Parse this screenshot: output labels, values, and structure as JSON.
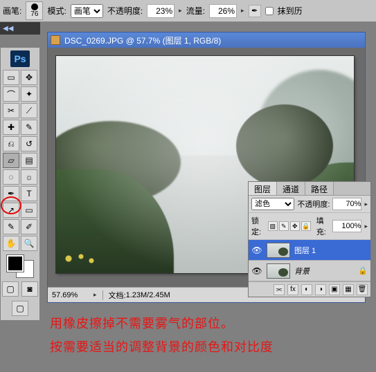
{
  "options_bar": {
    "brush_label": "画笔:",
    "brush_size": "76",
    "mode_label": "模式:",
    "mode_value": "画笔",
    "opacity_label": "不透明度:",
    "opacity_value": "23%",
    "flow_label": "流量:",
    "flow_value": "26%",
    "erase_history_label": "抹到历"
  },
  "collapse_glyph": "◀◀",
  "ps_logo": "Ps",
  "doc": {
    "title": "DSC_0269.JPG @ 57.7% (图层 1, RGB/8)"
  },
  "status": {
    "zoom": "57.69%",
    "info_label": "文档:",
    "info_value": "1.23M/2.45M"
  },
  "layers_panel": {
    "tabs": {
      "layers": "图层",
      "channels": "通道",
      "paths": "路径"
    },
    "blend_mode": "滤色",
    "opacity_label": "不透明度:",
    "opacity_value": "70%",
    "lock_label": "锁定:",
    "fill_label": "填充:",
    "fill_value": "100%",
    "layer1_name": "图层 1",
    "bg_name": "背景"
  },
  "annotations": {
    "line1": "用橡皮擦掉不需要雾气的部位。",
    "line2": "按需要适当的调整背景的颜色和对比度"
  },
  "icons": {
    "airbrush": "✒",
    "move": "✥",
    "marquee": "▭",
    "lasso": "⌒",
    "wand": "✦",
    "crop": "✂",
    "slice": "⟋",
    "heal": "✚",
    "brush": "✎",
    "stamp": "⎌",
    "history": "↺",
    "eraser": "▱",
    "grad": "▤",
    "blur": "◌",
    "dodge": "☼",
    "pen": "✒",
    "type": "T",
    "path": "↗",
    "shape": "▭",
    "notes": "✎",
    "eyedrop": "✐",
    "hand": "✋",
    "zoom": "🔍",
    "eye": "👁",
    "lock": "🔒",
    "link": "⫘",
    "fx": "fx",
    "mask": "◐",
    "adj": "◑",
    "group": "▣",
    "new": "▦",
    "trash": "🗑"
  }
}
